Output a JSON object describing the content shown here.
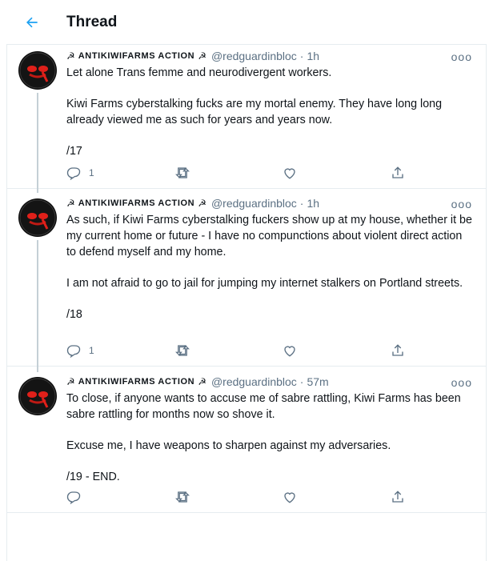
{
  "header": {
    "title": "Thread",
    "back_icon": "arrow-left-icon"
  },
  "tweets": [
    {
      "name": "AntiKiwiFarms Action",
      "handle": "@redguardinbloc",
      "time": "1h",
      "more_label": "ooo",
      "paragraphs": [
        "Let alone Trans femme and neurodivergent workers.",
        "Kiwi Farms cyberstalking fucks are my mortal enemy. They have long long already viewed me as such for years and years now.",
        "/17"
      ],
      "reply_count": "1",
      "retweet_count": "",
      "like_count": ""
    },
    {
      "name": "AntiKiwiFarms Action",
      "handle": "@redguardinbloc",
      "time": "1h",
      "more_label": "ooo",
      "paragraphs": [
        "As such, if Kiwi Farms cyberstalking fuckers show up at my house, whether it be my current home or future - I have no compunctions about violent direct action to defend myself and my home.",
        "I am not afraid to go to jail for jumping my internet stalkers on Portland streets.",
        "/18"
      ],
      "reply_count": "1",
      "retweet_count": "",
      "like_count": ""
    },
    {
      "name": "AntiKiwiFarms Action",
      "handle": "@redguardinbloc",
      "time": "57m",
      "more_label": "ooo",
      "paragraphs": [
        "To close, if anyone wants to accuse me of sabre rattling, Kiwi Farms has been sabre rattling for months now so shove it.",
        "Excuse me, I have weapons to sharpen against my adversaries.",
        "/19 - END."
      ],
      "reply_count": "",
      "retweet_count": "",
      "like_count": ""
    }
  ],
  "colors": {
    "accent": "#1da1f2",
    "secondary": "#5b7083",
    "border": "#e6ecf0",
    "thread_line": "#c4cfd6"
  }
}
